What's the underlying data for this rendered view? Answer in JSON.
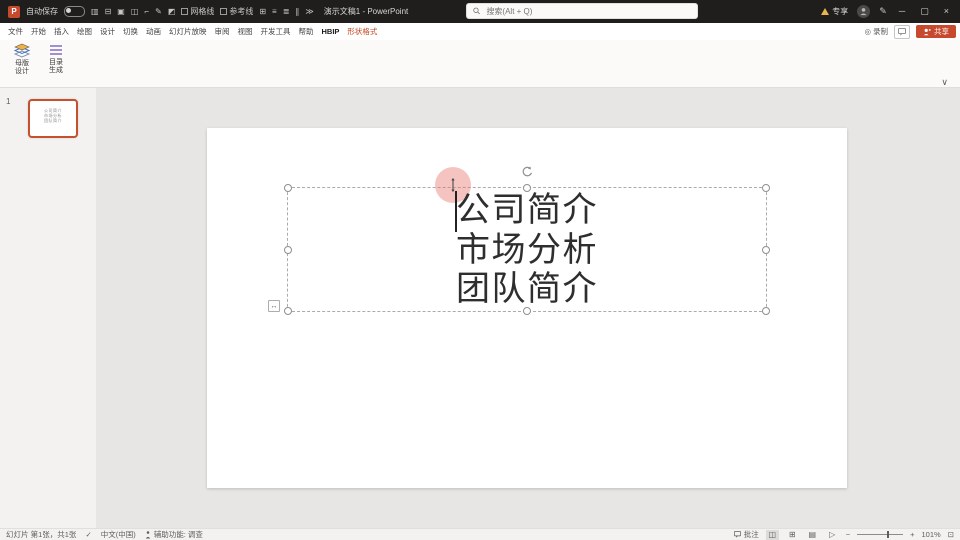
{
  "titlebar": {
    "autosave_label": "自动保存",
    "save_glyph": "▥",
    "qat": [
      "⊟",
      "▣",
      "◫",
      "⌐",
      "✎",
      "◩",
      "⊞",
      "≡",
      "≣",
      "∥"
    ],
    "gridlines_label": "网格线",
    "guides_label": "参考线",
    "more_glyph": "≫",
    "title": "演示文稿1 - PowerPoint",
    "search_placeholder": "搜索(Alt + Q)",
    "account_label": "专享",
    "pencil_glyph": "✎",
    "win_min": "─",
    "win_restore": "▢",
    "win_close": "×"
  },
  "ribbon": {
    "tabs": [
      "文件",
      "开始",
      "插入",
      "绘图",
      "设计",
      "切换",
      "动画",
      "幻灯片放映",
      "审阅",
      "视图",
      "开发工具",
      "帮助",
      "HBIP",
      "形状格式"
    ],
    "record_glyph": "◎",
    "record_label": "录制",
    "share_label": "共享",
    "buttons": [
      {
        "line1": "母版",
        "line2": "设计"
      },
      {
        "line1": "目录",
        "line2": "生成"
      }
    ],
    "collapse_glyph": "∨"
  },
  "panel": {
    "slide_number": "1"
  },
  "slide": {
    "lines": [
      "公司简介",
      "市场分析",
      "团队简介"
    ]
  },
  "statusbar": {
    "slide_indicator": "幻灯片 第1张，共1张",
    "proofing_glyph": "✓",
    "language": "中文(中国)",
    "accessibility": "辅助功能: 调查",
    "comments_label": "批注",
    "view_normal_glyph": "◫",
    "view_sorter_glyph": "⊞",
    "view_reading_glyph": "▤",
    "view_slideshow_glyph": "▷",
    "zoom_out": "−",
    "zoom_in": "+",
    "zoom_percent": "101%",
    "fit_glyph": "⊡"
  },
  "colors": {
    "accent_orange": "#c74a2e",
    "titlebar_bg": "#1f1e1d",
    "selection_border": "#ababab",
    "thumb_selected_border": "#c4502e",
    "touch_indicator": "rgba(232,115,106,0.42)"
  }
}
